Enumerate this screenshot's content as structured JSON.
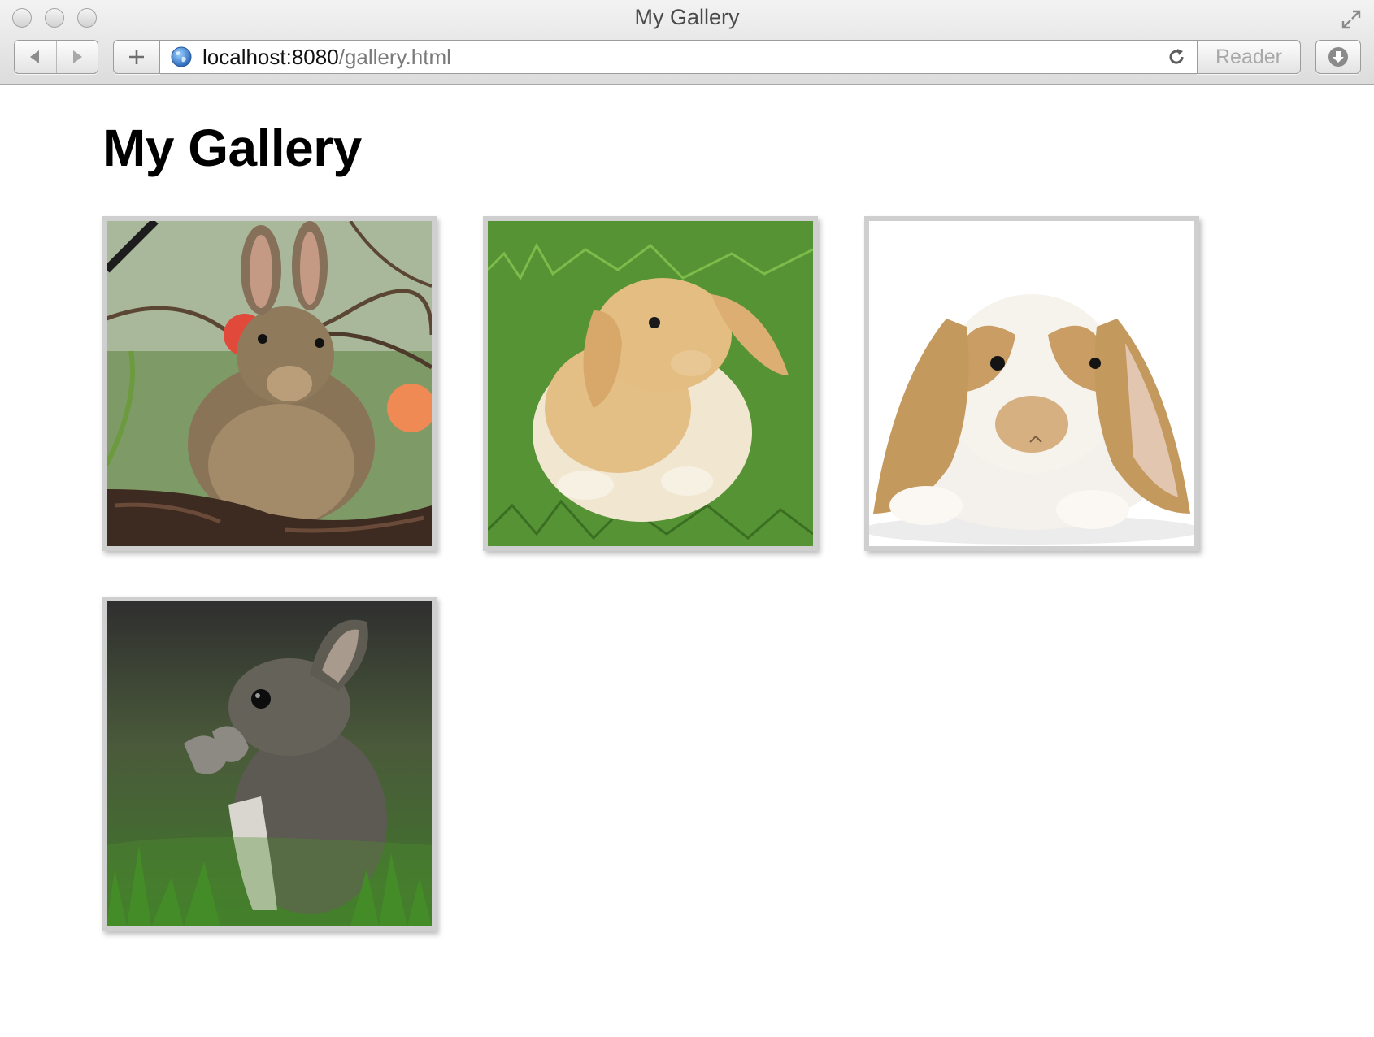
{
  "window": {
    "title": "My Gallery"
  },
  "toolbar": {
    "url_host": "localhost:8080",
    "url_path": "/gallery.html",
    "reader_label": "Reader"
  },
  "page": {
    "heading": "My Gallery"
  },
  "gallery": {
    "images": [
      {
        "subject": "wild brown rabbit on log"
      },
      {
        "subject": "fluffy orange lop rabbit on grass"
      },
      {
        "subject": "white and tan lop rabbit on white"
      },
      {
        "subject": "grey baby rabbit standing in grass"
      }
    ]
  },
  "colors": {
    "frame_border": "#cfcfcf",
    "chrome_top": "#f3f3f3",
    "chrome_bottom": "#dcdcdc",
    "heading": "#000000"
  }
}
